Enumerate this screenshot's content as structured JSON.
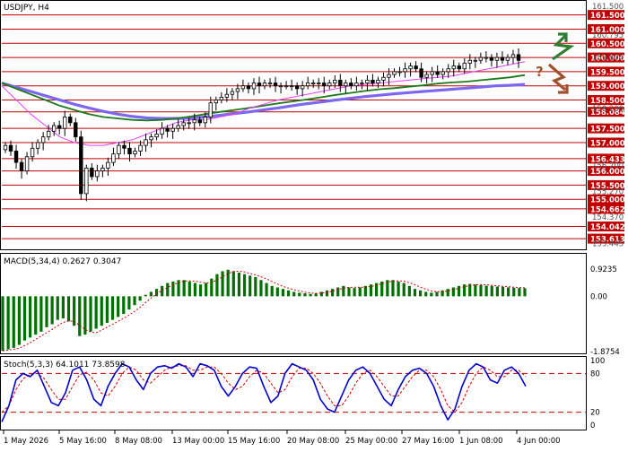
{
  "main_panel": {
    "symbol_label": "USDJPY, H4",
    "top_label": "161.500",
    "gray_labels": [
      {
        "v": 160.795,
        "text": "160.795"
      },
      {
        "v": 160.004,
        "text": "159.804"
      },
      {
        "v": 155.27,
        "text": "155.270"
      },
      {
        "v": 154.37,
        "text": "154.370"
      },
      {
        "v": 153.445,
        "text": "153.445"
      },
      {
        "v": 158.2,
        "text": "158.200"
      },
      {
        "v": 156.2,
        "text": "156.200"
      }
    ],
    "levels": [
      {
        "v": 161.5,
        "text": "161.500"
      },
      {
        "v": 161.0,
        "text": "161.000"
      },
      {
        "v": 160.5,
        "text": "160.500"
      },
      {
        "v": 160.0,
        "text": "160.000"
      },
      {
        "v": 159.5,
        "text": "159.500"
      },
      {
        "v": 159.0,
        "text": "159.000"
      },
      {
        "v": 158.5,
        "text": "158.500"
      },
      {
        "v": 158.084,
        "text": "158.084"
      },
      {
        "v": 157.5,
        "text": "157.500"
      },
      {
        "v": 157.0,
        "text": "157.000"
      },
      {
        "v": 156.433,
        "text": "156.433"
      },
      {
        "v": 156.0,
        "text": "156.000"
      },
      {
        "v": 155.5,
        "text": "155.500"
      },
      {
        "v": 155.0,
        "text": "155.000"
      },
      {
        "v": 154.662,
        "text": "154.662"
      },
      {
        "v": 154.042,
        "text": "154.042"
      },
      {
        "v": 153.613,
        "text": "153.613"
      }
    ],
    "level_color": "#c00000",
    "candle_color": "#000000"
  },
  "macd_panel": {
    "label": "MACD(5,34,4) 0.2627 0.3047",
    "axis_labels": [
      {
        "v": 0.9235,
        "text": "0.9235"
      },
      {
        "v": 0.0,
        "text": "0.00"
      },
      {
        "v": -1.8754,
        "text": "-1.8754"
      }
    ],
    "bar_color": "#007000"
  },
  "stoch_panel": {
    "label": "Stoch(5,3,3) 64.1011 73.8598",
    "axis_labels": [
      {
        "v": 100,
        "text": "100"
      },
      {
        "v": 80,
        "text": "80"
      },
      {
        "v": 20,
        "text": "20"
      },
      {
        "v": 0,
        "text": "0"
      }
    ],
    "main_color": "#0000cc",
    "signal_color": "#cc0000",
    "dash_color": "#cc0000"
  },
  "x_axis": {
    "labels": [
      "1 May 2026",
      "5 May 16:00",
      "8 May 08:00",
      "13 May 00:00",
      "15 May 16:00",
      "20 May 08:00",
      "25 May 00:00",
      "27 May 16:00",
      "1 Jun 08:00",
      "4 Jun 00:00"
    ]
  },
  "forecast": {
    "question_mark": "?",
    "up_color": "#2e7d32",
    "down_color": "#a0522d"
  },
  "chart_data": {
    "type": "candlestick",
    "title": "USDJPY, H4",
    "ylim": [
      153.3,
      161.9
    ],
    "close": [
      156.9,
      156.7,
      156.3,
      156.0,
      156.5,
      156.8,
      157.0,
      157.2,
      157.4,
      157.6,
      157.5,
      157.9,
      157.7,
      157.2,
      155.2,
      156.1,
      155.8,
      156.0,
      156.1,
      156.3,
      156.6,
      156.9,
      156.8,
      156.6,
      156.7,
      156.9,
      157.1,
      157.2,
      157.3,
      157.5,
      157.4,
      157.5,
      157.6,
      157.7,
      157.7,
      157.8,
      157.7,
      157.9,
      158.4,
      158.5,
      158.6,
      158.7,
      158.8,
      158.9,
      159.0,
      158.9,
      159.1,
      159.0,
      159.1,
      159.1,
      159.0,
      159.0,
      159.0,
      159.0,
      158.9,
      159.0,
      159.1,
      159.1,
      159.1,
      159.0,
      159.1,
      159.2,
      159.0,
      159.1,
      159.0,
      159.1,
      159.1,
      159.2,
      159.1,
      159.2,
      159.3,
      159.4,
      159.5,
      159.5,
      159.6,
      159.7,
      159.6,
      159.3,
      159.4,
      159.5,
      159.4,
      159.5,
      159.6,
      159.7,
      159.6,
      159.8,
      159.9,
      159.9,
      160.0,
      160.0,
      159.9,
      160.0,
      159.9,
      160.0,
      160.1,
      159.9
    ],
    "ma_green": [
      159.1,
      158.9,
      158.7,
      158.5,
      158.3,
      158.15,
      158.0,
      157.9,
      157.85,
      157.8,
      157.78,
      157.8,
      157.85,
      157.92,
      158.0,
      158.08,
      158.15,
      158.22,
      158.3,
      158.38,
      158.45,
      158.52,
      158.6,
      158.68,
      158.75,
      158.82,
      158.88,
      158.92,
      158.97,
      159.02,
      159.08,
      159.12,
      159.15,
      159.2,
      159.25,
      159.3,
      159.38
    ],
    "ma_purple": [
      159.1,
      158.95,
      158.8,
      158.65,
      158.5,
      158.35,
      158.22,
      158.1,
      158.0,
      157.92,
      157.87,
      157.85,
      157.85,
      157.86,
      157.9,
      157.96,
      158.02,
      158.08,
      158.15,
      158.22,
      158.3,
      158.37,
      158.43,
      158.5,
      158.56,
      158.62,
      158.67,
      158.72,
      158.76,
      158.8,
      158.84,
      158.88,
      158.92,
      158.96,
      159.0,
      159.02,
      159.05
    ],
    "ma_magenta": [
      159.0,
      158.5,
      158.0,
      157.6,
      157.2,
      157.0,
      156.9,
      156.9,
      157.0,
      157.1,
      157.3,
      157.5,
      157.7,
      157.8,
      157.8,
      157.9,
      158.0,
      158.2,
      158.35,
      158.5,
      158.6,
      158.7,
      158.8,
      158.9,
      159.0,
      159.05,
      159.1,
      159.15,
      159.2,
      159.25,
      159.3,
      159.35,
      159.45,
      159.55,
      159.65,
      159.75,
      159.85
    ],
    "macd": [
      -1.85,
      -1.8,
      -1.75,
      -1.65,
      -1.5,
      -1.4,
      -1.3,
      -1.2,
      -1.05,
      -0.95,
      -0.8,
      -0.75,
      -0.85,
      -1.0,
      -1.35,
      -1.3,
      -1.2,
      -1.1,
      -1.0,
      -0.9,
      -0.8,
      -0.7,
      -0.6,
      -0.45,
      -0.3,
      -0.15,
      0.05,
      0.15,
      0.25,
      0.35,
      0.45,
      0.5,
      0.55,
      0.55,
      0.5,
      0.45,
      0.4,
      0.45,
      0.6,
      0.75,
      0.85,
      0.9,
      0.85,
      0.8,
      0.75,
      0.7,
      0.65,
      0.55,
      0.45,
      0.35,
      0.3,
      0.25,
      0.2,
      0.15,
      0.12,
      0.1,
      0.08,
      0.1,
      0.15,
      0.2,
      0.25,
      0.3,
      0.35,
      0.3,
      0.28,
      0.3,
      0.35,
      0.4,
      0.45,
      0.5,
      0.55,
      0.55,
      0.5,
      0.45,
      0.35,
      0.25,
      0.2,
      0.15,
      0.12,
      0.15,
      0.2,
      0.25,
      0.3,
      0.35,
      0.4,
      0.42,
      0.4,
      0.38,
      0.36,
      0.35,
      0.33,
      0.32,
      0.3,
      0.29,
      0.28,
      0.27
    ],
    "stoch_main": [
      5,
      30,
      70,
      80,
      75,
      85,
      60,
      35,
      30,
      50,
      85,
      90,
      70,
      40,
      30,
      60,
      80,
      95,
      90,
      70,
      55,
      80,
      90,
      92,
      88,
      95,
      90,
      75,
      95,
      92,
      85,
      60,
      45,
      60,
      80,
      90,
      88,
      60,
      35,
      45,
      80,
      95,
      90,
      85,
      70,
      40,
      25,
      20,
      45,
      70,
      85,
      90,
      80,
      60,
      40,
      30,
      55,
      75,
      85,
      88,
      80,
      60,
      30,
      8,
      25,
      60,
      85,
      95,
      90,
      70,
      65,
      85,
      90,
      80,
      60
    ],
    "stoch_signal": [
      20,
      30,
      55,
      72,
      78,
      80,
      72,
      55,
      40,
      40,
      60,
      78,
      82,
      70,
      50,
      45,
      60,
      80,
      90,
      85,
      70,
      65,
      75,
      85,
      90,
      92,
      92,
      85,
      85,
      90,
      90,
      80,
      65,
      55,
      60,
      75,
      85,
      80,
      65,
      50,
      55,
      75,
      88,
      88,
      80,
      65,
      45,
      30,
      30,
      45,
      65,
      80,
      85,
      75,
      60,
      45,
      45,
      60,
      75,
      85,
      85,
      75,
      55,
      30,
      20,
      35,
      60,
      80,
      90,
      85,
      75,
      75,
      85,
      85,
      75
    ]
  }
}
